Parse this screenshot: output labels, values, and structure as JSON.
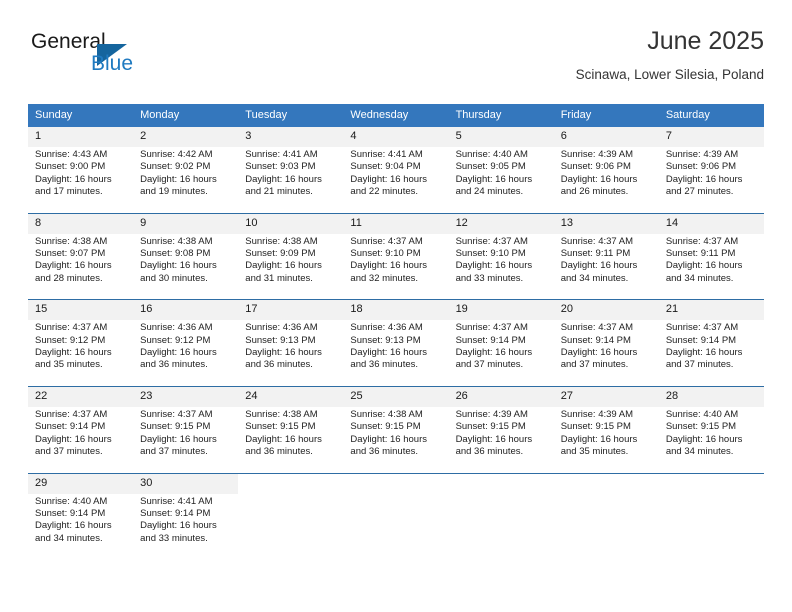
{
  "logo": {
    "word_one": "General",
    "word_two": "Blue",
    "icon": "triangle-logo-icon"
  },
  "header": {
    "title": "June 2025",
    "subtitle": "Scinawa, Lower Silesia, Poland"
  },
  "colors": {
    "header_blue": "#3477bd",
    "separator_blue": "#2e6da4",
    "daynum_band": "#f2f2f2",
    "logo_blue": "#1f7ac0",
    "text": "#222222"
  },
  "calendar": {
    "weekday_headers": [
      "Sunday",
      "Monday",
      "Tuesday",
      "Wednesday",
      "Thursday",
      "Friday",
      "Saturday"
    ],
    "weeks": [
      {
        "daynums": [
          "1",
          "2",
          "3",
          "4",
          "5",
          "6",
          "7"
        ],
        "cells": [
          {
            "sunrise": "Sunrise: 4:43 AM",
            "sunset": "Sunset: 9:00 PM",
            "daylight_1": "Daylight: 16 hours",
            "daylight_2": "and 17 minutes."
          },
          {
            "sunrise": "Sunrise: 4:42 AM",
            "sunset": "Sunset: 9:02 PM",
            "daylight_1": "Daylight: 16 hours",
            "daylight_2": "and 19 minutes."
          },
          {
            "sunrise": "Sunrise: 4:41 AM",
            "sunset": "Sunset: 9:03 PM",
            "daylight_1": "Daylight: 16 hours",
            "daylight_2": "and 21 minutes."
          },
          {
            "sunrise": "Sunrise: 4:41 AM",
            "sunset": "Sunset: 9:04 PM",
            "daylight_1": "Daylight: 16 hours",
            "daylight_2": "and 22 minutes."
          },
          {
            "sunrise": "Sunrise: 4:40 AM",
            "sunset": "Sunset: 9:05 PM",
            "daylight_1": "Daylight: 16 hours",
            "daylight_2": "and 24 minutes."
          },
          {
            "sunrise": "Sunrise: 4:39 AM",
            "sunset": "Sunset: 9:06 PM",
            "daylight_1": "Daylight: 16 hours",
            "daylight_2": "and 26 minutes."
          },
          {
            "sunrise": "Sunrise: 4:39 AM",
            "sunset": "Sunset: 9:06 PM",
            "daylight_1": "Daylight: 16 hours",
            "daylight_2": "and 27 minutes."
          }
        ]
      },
      {
        "daynums": [
          "8",
          "9",
          "10",
          "11",
          "12",
          "13",
          "14"
        ],
        "cells": [
          {
            "sunrise": "Sunrise: 4:38 AM",
            "sunset": "Sunset: 9:07 PM",
            "daylight_1": "Daylight: 16 hours",
            "daylight_2": "and 28 minutes."
          },
          {
            "sunrise": "Sunrise: 4:38 AM",
            "sunset": "Sunset: 9:08 PM",
            "daylight_1": "Daylight: 16 hours",
            "daylight_2": "and 30 minutes."
          },
          {
            "sunrise": "Sunrise: 4:38 AM",
            "sunset": "Sunset: 9:09 PM",
            "daylight_1": "Daylight: 16 hours",
            "daylight_2": "and 31 minutes."
          },
          {
            "sunrise": "Sunrise: 4:37 AM",
            "sunset": "Sunset: 9:10 PM",
            "daylight_1": "Daylight: 16 hours",
            "daylight_2": "and 32 minutes."
          },
          {
            "sunrise": "Sunrise: 4:37 AM",
            "sunset": "Sunset: 9:10 PM",
            "daylight_1": "Daylight: 16 hours",
            "daylight_2": "and 33 minutes."
          },
          {
            "sunrise": "Sunrise: 4:37 AM",
            "sunset": "Sunset: 9:11 PM",
            "daylight_1": "Daylight: 16 hours",
            "daylight_2": "and 34 minutes."
          },
          {
            "sunrise": "Sunrise: 4:37 AM",
            "sunset": "Sunset: 9:11 PM",
            "daylight_1": "Daylight: 16 hours",
            "daylight_2": "and 34 minutes."
          }
        ]
      },
      {
        "daynums": [
          "15",
          "16",
          "17",
          "18",
          "19",
          "20",
          "21"
        ],
        "cells": [
          {
            "sunrise": "Sunrise: 4:37 AM",
            "sunset": "Sunset: 9:12 PM",
            "daylight_1": "Daylight: 16 hours",
            "daylight_2": "and 35 minutes."
          },
          {
            "sunrise": "Sunrise: 4:36 AM",
            "sunset": "Sunset: 9:12 PM",
            "daylight_1": "Daylight: 16 hours",
            "daylight_2": "and 36 minutes."
          },
          {
            "sunrise": "Sunrise: 4:36 AM",
            "sunset": "Sunset: 9:13 PM",
            "daylight_1": "Daylight: 16 hours",
            "daylight_2": "and 36 minutes."
          },
          {
            "sunrise": "Sunrise: 4:36 AM",
            "sunset": "Sunset: 9:13 PM",
            "daylight_1": "Daylight: 16 hours",
            "daylight_2": "and 36 minutes."
          },
          {
            "sunrise": "Sunrise: 4:37 AM",
            "sunset": "Sunset: 9:14 PM",
            "daylight_1": "Daylight: 16 hours",
            "daylight_2": "and 37 minutes."
          },
          {
            "sunrise": "Sunrise: 4:37 AM",
            "sunset": "Sunset: 9:14 PM",
            "daylight_1": "Daylight: 16 hours",
            "daylight_2": "and 37 minutes."
          },
          {
            "sunrise": "Sunrise: 4:37 AM",
            "sunset": "Sunset: 9:14 PM",
            "daylight_1": "Daylight: 16 hours",
            "daylight_2": "and 37 minutes."
          }
        ]
      },
      {
        "daynums": [
          "22",
          "23",
          "24",
          "25",
          "26",
          "27",
          "28"
        ],
        "cells": [
          {
            "sunrise": "Sunrise: 4:37 AM",
            "sunset": "Sunset: 9:14 PM",
            "daylight_1": "Daylight: 16 hours",
            "daylight_2": "and 37 minutes."
          },
          {
            "sunrise": "Sunrise: 4:37 AM",
            "sunset": "Sunset: 9:15 PM",
            "daylight_1": "Daylight: 16 hours",
            "daylight_2": "and 37 minutes."
          },
          {
            "sunrise": "Sunrise: 4:38 AM",
            "sunset": "Sunset: 9:15 PM",
            "daylight_1": "Daylight: 16 hours",
            "daylight_2": "and 36 minutes."
          },
          {
            "sunrise": "Sunrise: 4:38 AM",
            "sunset": "Sunset: 9:15 PM",
            "daylight_1": "Daylight: 16 hours",
            "daylight_2": "and 36 minutes."
          },
          {
            "sunrise": "Sunrise: 4:39 AM",
            "sunset": "Sunset: 9:15 PM",
            "daylight_1": "Daylight: 16 hours",
            "daylight_2": "and 36 minutes."
          },
          {
            "sunrise": "Sunrise: 4:39 AM",
            "sunset": "Sunset: 9:15 PM",
            "daylight_1": "Daylight: 16 hours",
            "daylight_2": "and 35 minutes."
          },
          {
            "sunrise": "Sunrise: 4:40 AM",
            "sunset": "Sunset: 9:15 PM",
            "daylight_1": "Daylight: 16 hours",
            "daylight_2": "and 34 minutes."
          }
        ]
      },
      {
        "daynums": [
          "29",
          "30",
          "",
          "",
          "",
          "",
          ""
        ],
        "cells": [
          {
            "sunrise": "Sunrise: 4:40 AM",
            "sunset": "Sunset: 9:14 PM",
            "daylight_1": "Daylight: 16 hours",
            "daylight_2": "and 34 minutes."
          },
          {
            "sunrise": "Sunrise: 4:41 AM",
            "sunset": "Sunset: 9:14 PM",
            "daylight_1": "Daylight: 16 hours",
            "daylight_2": "and 33 minutes."
          },
          {
            "sunrise": "",
            "sunset": "",
            "daylight_1": "",
            "daylight_2": ""
          },
          {
            "sunrise": "",
            "sunset": "",
            "daylight_1": "",
            "daylight_2": ""
          },
          {
            "sunrise": "",
            "sunset": "",
            "daylight_1": "",
            "daylight_2": ""
          },
          {
            "sunrise": "",
            "sunset": "",
            "daylight_1": "",
            "daylight_2": ""
          },
          {
            "sunrise": "",
            "sunset": "",
            "daylight_1": "",
            "daylight_2": ""
          }
        ]
      }
    ]
  }
}
